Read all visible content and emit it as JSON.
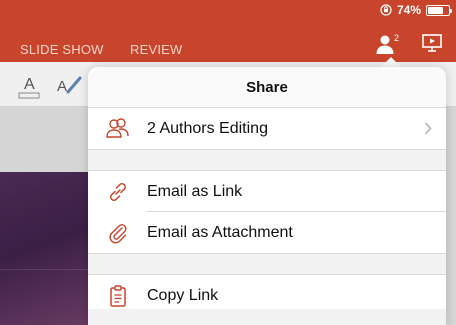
{
  "status_bar": {
    "battery_percent": "74%",
    "battery_level": 0.74,
    "rotation_lock_icon": "rotation-lock-icon"
  },
  "ribbon": {
    "tabs": [
      {
        "label": "SLIDE SHOW"
      },
      {
        "label": "REVIEW"
      }
    ],
    "authors_count": "2",
    "accent_color": "#c8442a"
  },
  "share_popover": {
    "title": "Share",
    "items": [
      {
        "label": "2 Authors Editing",
        "icon": "authors-icon",
        "has_chevron": true
      },
      {
        "label": "Email as Link",
        "icon": "link-icon"
      },
      {
        "label": "Email as Attachment",
        "icon": "paperclip-icon"
      },
      {
        "label": "Copy Link",
        "icon": "clipboard-icon"
      }
    ],
    "icon_color": "#c8442a"
  }
}
